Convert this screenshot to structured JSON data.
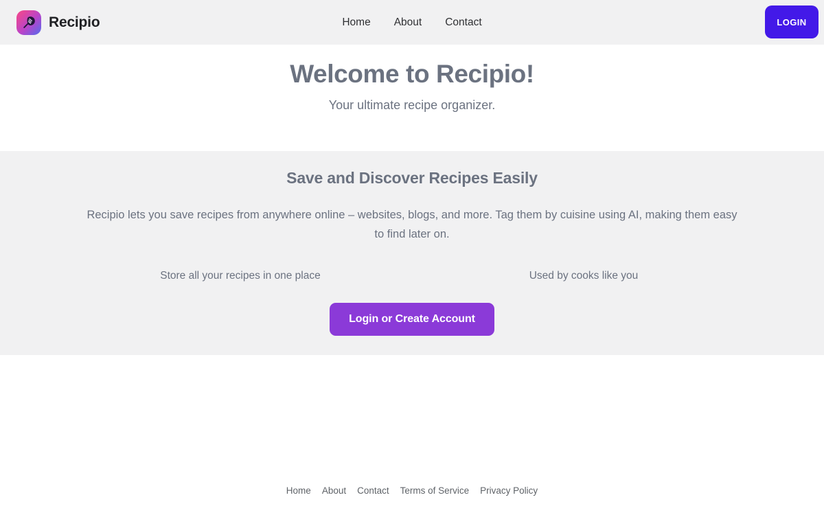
{
  "header": {
    "brand_name": "Recipio",
    "logo_icon": "spatula-icon",
    "nav": [
      {
        "label": "Home"
      },
      {
        "label": "About"
      },
      {
        "label": "Contact"
      }
    ],
    "login_button": "LOGIN"
  },
  "hero": {
    "title": "Welcome to Recipio!",
    "subtitle": "Your ultimate recipe organizer."
  },
  "feature_panel": {
    "title": "Save and Discover Recipes Easily",
    "description": "Recipio lets you save recipes from anywhere online – websites, blogs, and more. Tag them by cuisine using AI, making them easy to find later on.",
    "columns": [
      {
        "label": "Store all your recipes in one place"
      },
      {
        "label": "Used by cooks like you"
      }
    ],
    "cta_label": "Login or Create Account"
  },
  "footer": {
    "links": [
      {
        "label": "Home"
      },
      {
        "label": "About"
      },
      {
        "label": "Contact"
      },
      {
        "label": "Terms of Service"
      },
      {
        "label": "Privacy Policy"
      }
    ]
  },
  "colors": {
    "header_bg": "#f1f1f2",
    "panel_bg": "#f1f1f2",
    "login_button": "#4319e8",
    "cta_button": "#8b3ad8",
    "muted_text": "#6b7280",
    "brand_text": "#202124"
  }
}
